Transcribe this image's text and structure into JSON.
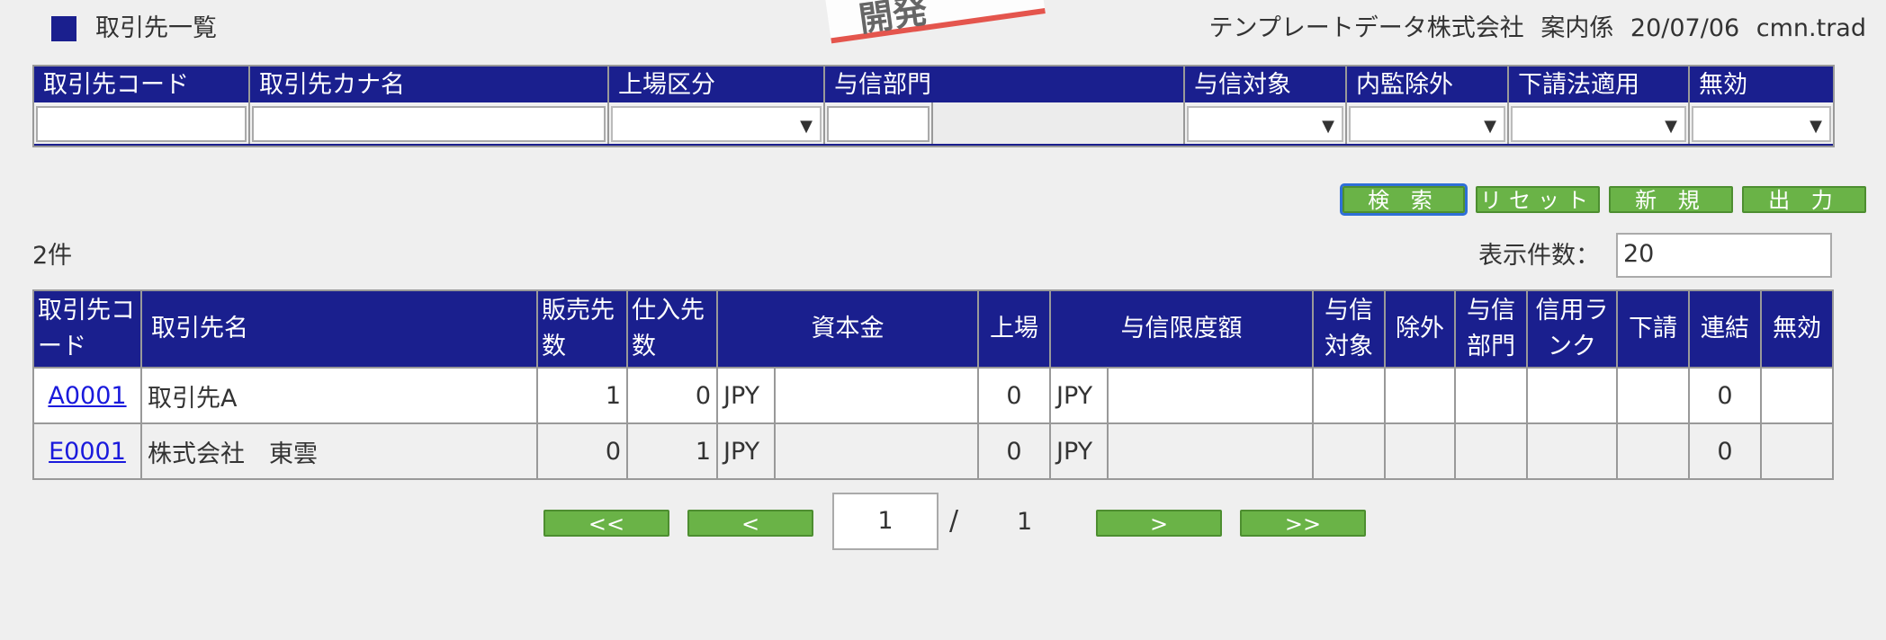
{
  "header": {
    "title": "取引先一覧",
    "company": "テンプレートデータ株式会社",
    "role": "案内係",
    "date": "20/07/06",
    "user": "cmn.trad",
    "stamp": "開発"
  },
  "search": {
    "headers": [
      "取引先コード",
      "取引先カナ名",
      "上場区分",
      "与信部門",
      "与信対象",
      "内監除外",
      "下請法適用",
      "無効"
    ],
    "select_arrow": "▼"
  },
  "buttons": {
    "search": "検 索",
    "reset": "リセット",
    "new": "新 規",
    "output": "出 力"
  },
  "result_count": "2件",
  "display_count": {
    "label": "表示件数：",
    "value": "20"
  },
  "table": {
    "headers": {
      "code": "取引先コード",
      "name": "取引先名",
      "sales": "販売先数",
      "purchase": "仕入先数",
      "capital": "資本金",
      "listed": "上場",
      "credit_limit": "与信限度額",
      "credit_target": "与信対象",
      "excluded": "除外",
      "credit_dept": "与信部門",
      "credit_rank": "信用ランク",
      "subcontract": "下請",
      "consolidated": "連結",
      "invalid": "無効"
    },
    "rows": [
      {
        "code": "A0001",
        "name": "取引先A",
        "sales": "1",
        "purchase": "0",
        "capital_currency": "JPY",
        "listed": "0",
        "credit_currency": "JPY",
        "consolidated": "0"
      },
      {
        "code": "E0001",
        "name": "株式会社　東雲",
        "sales": "0",
        "purchase": "1",
        "capital_currency": "JPY",
        "listed": "0",
        "credit_currency": "JPY",
        "consolidated": "0"
      }
    ]
  },
  "pagination": {
    "first": "<<",
    "prev": "<",
    "current": "1",
    "separator": "/",
    "total": "1",
    "next": ">",
    "last": ">>"
  }
}
